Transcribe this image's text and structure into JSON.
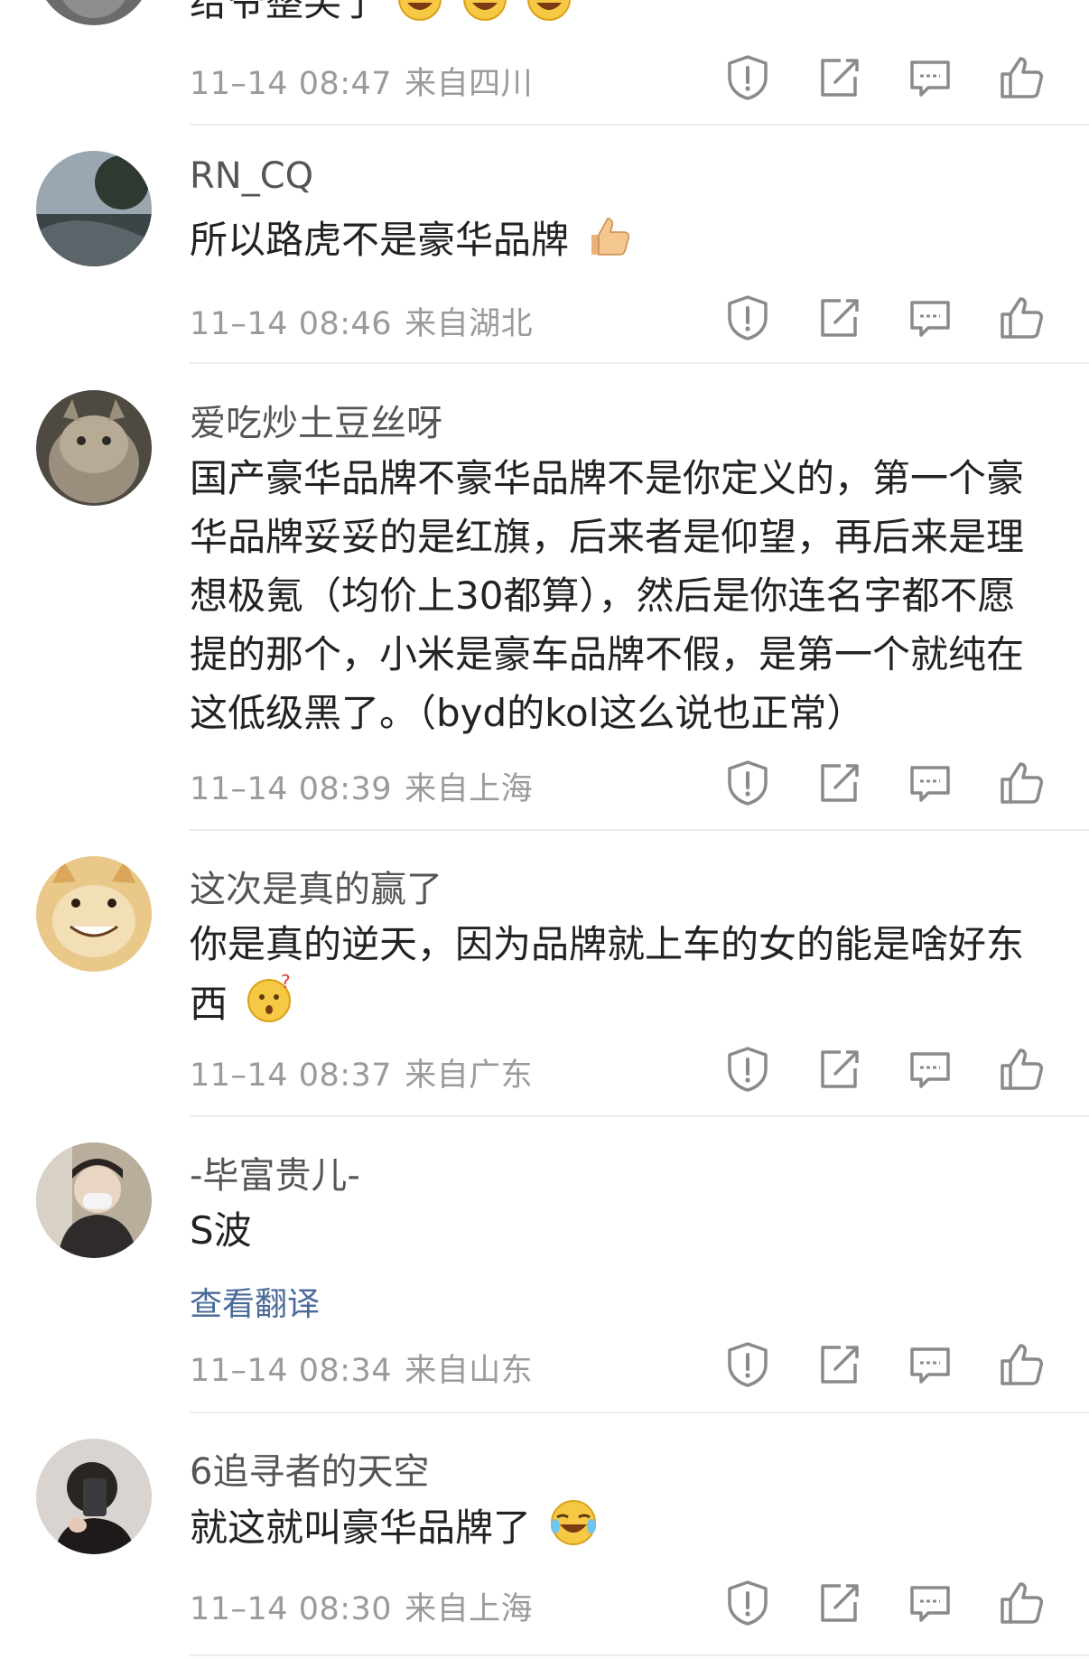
{
  "comments": [
    {
      "username": "",
      "text": "给爷整笑了",
      "time": "11–14 08:47",
      "location": "来自四川"
    },
    {
      "username": "RN_CQ",
      "text": "所以路虎不是豪华品牌",
      "time": "11–14 08:46",
      "location": "来自湖北"
    },
    {
      "username": "爱吃炒土豆丝呀",
      "text": "国产豪华品牌不豪华品牌不是你定义的，第一个豪华品牌妥妥的是红旗，后来者是仰望，再后来是理想极氪（均价上30都算），然后是你连名字都不愿提的那个，小米是豪车品牌不假，是第一个就纯在这低级黑了。（byd的kol这么说也正常）",
      "time": "11–14 08:39",
      "location": "来自上海"
    },
    {
      "username": "这次是真的赢了",
      "text": "你是真的逆天，因为品牌就上车的女的能是啥好东西",
      "time": "11–14 08:37",
      "location": "来自广东"
    },
    {
      "username": "-毕富贵儿-",
      "text": "S波",
      "translate": "查看翻译",
      "time": "11–14 08:34",
      "location": "来自山东"
    },
    {
      "username": "6追寻者的天空",
      "text": "就这就叫豪华品牌了",
      "time": "11–14 08:30",
      "location": "来自上海"
    }
  ],
  "icons": [
    "report-icon",
    "repost-icon",
    "reply-icon",
    "like-icon"
  ],
  "colors": {
    "meta": "#9a9a9a",
    "link": "#4a6a9a",
    "divider": "#ececec",
    "icon": "#8a8a8a"
  }
}
